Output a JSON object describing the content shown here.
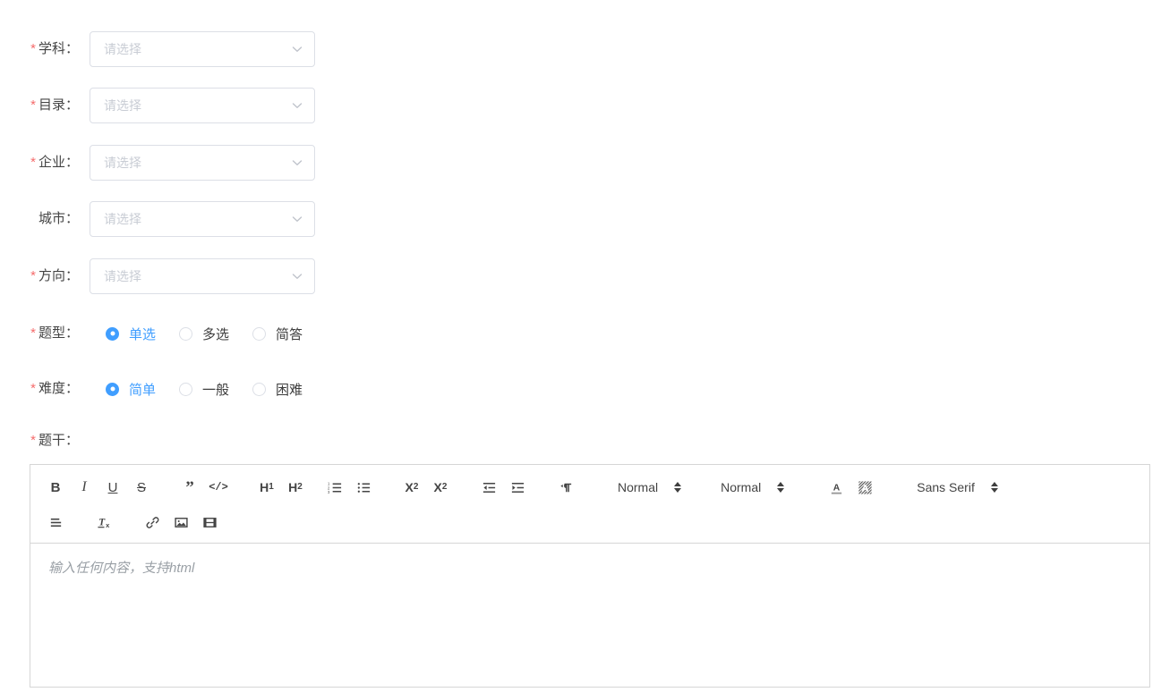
{
  "form": {
    "placeholder_select": "请选择",
    "fields": [
      {
        "label": "学科：",
        "required": true,
        "name": "subject"
      },
      {
        "label": "目录：",
        "required": true,
        "name": "catalog"
      },
      {
        "label": "企业：",
        "required": true,
        "name": "enterprise"
      },
      {
        "label": "城市：",
        "required": false,
        "name": "city"
      },
      {
        "label": "方向：",
        "required": true,
        "name": "direction"
      }
    ],
    "radio_groups": [
      {
        "label": "题型：",
        "required": true,
        "name": "question-type",
        "options": [
          {
            "text": "单选",
            "checked": true
          },
          {
            "text": "多选",
            "checked": false
          },
          {
            "text": "简答",
            "checked": false
          }
        ]
      },
      {
        "label": "难度：",
        "required": true,
        "name": "difficulty",
        "options": [
          {
            "text": "简单",
            "checked": true
          },
          {
            "text": "一般",
            "checked": false
          },
          {
            "text": "困难",
            "checked": false
          }
        ]
      }
    ],
    "required_marker": "*"
  },
  "editor": {
    "label": "题干：",
    "required": true,
    "placeholder": "输入任何内容，支持html",
    "toolbar": {
      "bold": "B",
      "italic": "I",
      "underline": "U",
      "strike": "S",
      "blockquote": "”",
      "code_block": "</>",
      "header1": "H",
      "header1_sub": "1",
      "header2": "H",
      "header2_sub": "2",
      "subscript": "X",
      "subscript_sub": "2",
      "superscript": "X",
      "superscript_sup": "2",
      "size_value": "Normal",
      "header_value": "Normal",
      "font_value": "Sans Serif"
    }
  },
  "colors": {
    "accent": "#409eff",
    "required": "#f56c6c",
    "border": "#dcdfe6",
    "placeholder": "#c8ccd4",
    "editor_border": "#d6d6d6",
    "icon": "#444444"
  }
}
